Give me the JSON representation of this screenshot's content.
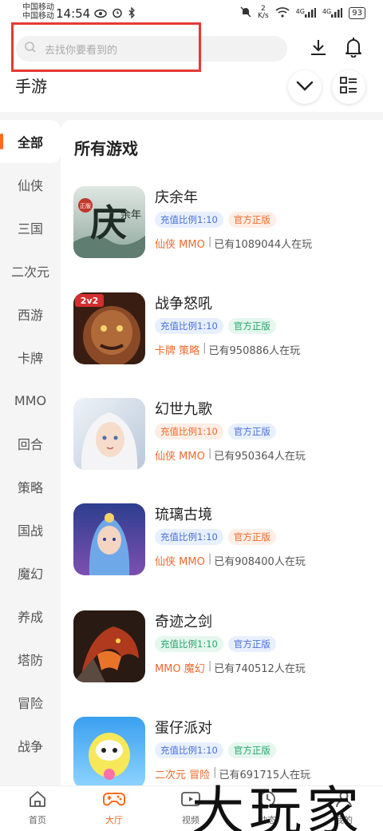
{
  "status_bar": {
    "carrier_1": "中国移动",
    "carrier_2": "中国移动",
    "time": "14:54",
    "net_speed_value": "2",
    "net_speed_unit": "K/s",
    "signal_1": "4G",
    "signal_2": "4G",
    "battery": "93"
  },
  "header": {
    "search_placeholder": "去找你要看到的",
    "title": "手游"
  },
  "categories": [
    {
      "label": "全部"
    },
    {
      "label": "仙侠"
    },
    {
      "label": "三国"
    },
    {
      "label": "二次元"
    },
    {
      "label": "西游"
    },
    {
      "label": "卡牌"
    },
    {
      "label": "MMO"
    },
    {
      "label": "回合"
    },
    {
      "label": "策略"
    },
    {
      "label": "国战"
    },
    {
      "label": "魔幻"
    },
    {
      "label": "养成"
    },
    {
      "label": "塔防"
    },
    {
      "label": "冒险"
    },
    {
      "label": "战争"
    }
  ],
  "section_title": "所有游戏",
  "games": [
    {
      "name": "庆余年",
      "tag1": "充值比例1:10",
      "tag2": "官方正版",
      "genre": "仙侠 MMO",
      "players": "已有1089044人在玩"
    },
    {
      "name": "战争怒吼",
      "tag1": "充值比例1:10",
      "tag2": "官方正版",
      "genre": "卡牌 策略",
      "players": "已有950886人在玩"
    },
    {
      "name": "幻世九歌",
      "tag1": "充值比例1:10",
      "tag2": "官方正版",
      "genre": "仙侠 MMO",
      "players": "已有950364人在玩"
    },
    {
      "name": "琉璃古境",
      "tag1": "充值比例1:10",
      "tag2": "官方正版",
      "genre": "仙侠 MMO",
      "players": "已有908400人在玩"
    },
    {
      "name": "奇迹之剑",
      "tag1": "充值比例1:10",
      "tag2": "官方正版",
      "genre": "MMO 魔幻",
      "players": "已有740512人在玩"
    },
    {
      "name": "蛋仔派对",
      "tag1": "充值比例1:10",
      "tag2": "官方正版",
      "genre": "二次元 冒险",
      "players": "已有691715人在玩"
    }
  ],
  "thumb_text": {
    "qyn_badge": "正版",
    "qyn_logo": "庆",
    "qyn_sub": "余年",
    "zznh_badge": "2v2"
  },
  "bottom_nav": [
    {
      "label": "首页"
    },
    {
      "label": "大厅"
    },
    {
      "label": "视频"
    },
    {
      "label": "动态"
    },
    {
      "label": "我的"
    }
  ],
  "watermark": "大玩家",
  "colors": {
    "accent": "#ff6a1a",
    "tag_blue": "#4a6fd8",
    "tag_green": "#26a86a",
    "tag_orange": "#f06a2c",
    "highlight": "#e53935"
  }
}
